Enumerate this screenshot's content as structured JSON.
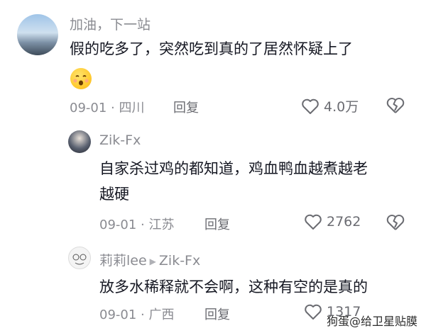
{
  "comments": [
    {
      "username": "加油，下一站",
      "text_line1": "假的吃多了，突然吃到真的了居然怀疑上了",
      "emoji": "face-with-open-mouth-sweat-emoji",
      "date": "09-01 · 四川",
      "reply": "回复",
      "likes": "4.0万"
    },
    {
      "username": "Zik-Fx",
      "text_line1": "自家杀过鸡的都知道，鸡血鸭血越煮越老",
      "text_line2": "越硬",
      "date": "09-01 · 江苏",
      "reply": "回复",
      "likes": "2762"
    },
    {
      "username": "莉莉lee",
      "reply_to": "Zik-Fx",
      "text_line1": "放多水稀释就不会啊，这种有空的是真的",
      "date": "09-01 · 广西",
      "reply": "回复",
      "likes": "1317"
    }
  ],
  "watermark": "狗蛋@给卫星贴膜",
  "colors": {
    "text": "#161823",
    "meta": "#8a8b91",
    "icon": "#6b6c72"
  }
}
